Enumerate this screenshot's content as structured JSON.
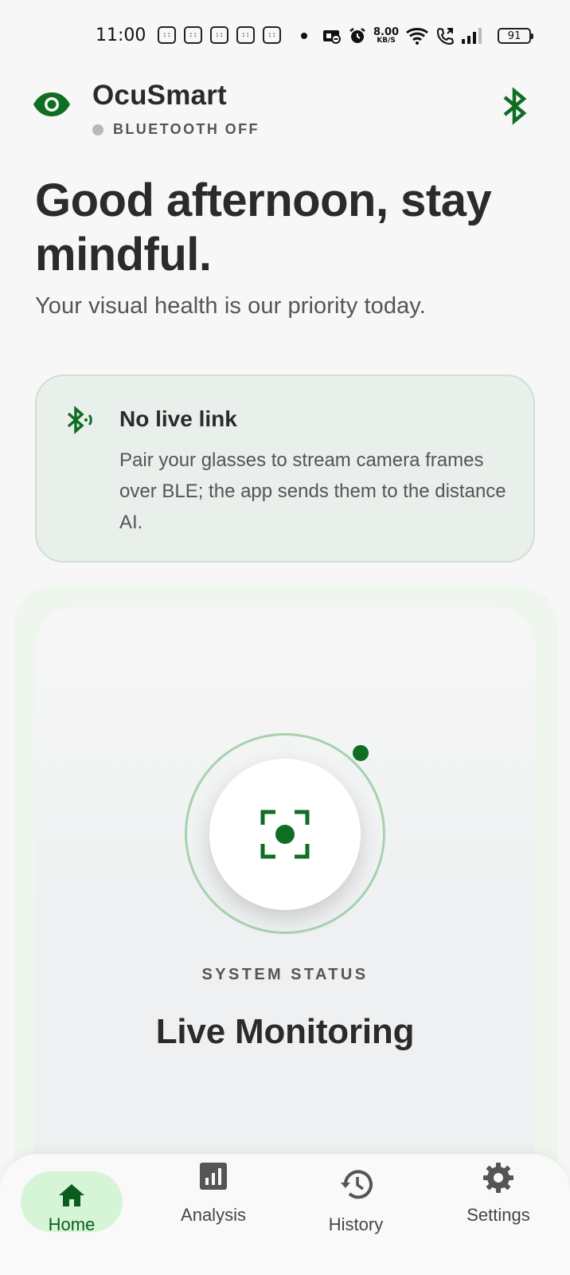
{
  "status_bar": {
    "time": "11:00",
    "notification_glyphs": [
      "::",
      "::",
      "::",
      "::",
      "::"
    ],
    "net_speed_value": "8.00",
    "net_speed_unit": "KB/S",
    "battery": "91"
  },
  "header": {
    "app_name": "OcuSmart",
    "bluetooth_status": "BLUETOOTH OFF",
    "brand_color": "#0f6e23",
    "eye_icon": "eye-icon",
    "bluetooth_icon": "bluetooth-icon"
  },
  "greeting": {
    "title": "Good afternoon, stay mindful.",
    "subtitle": "Your visual health is our priority today."
  },
  "info_card": {
    "icon": "bluetooth-searching-icon",
    "title": "No live link",
    "body": "Pair your glasses to stream camera frames over BLE; the app sends them to the distance AI."
  },
  "status_panel": {
    "label": "SYSTEM STATUS",
    "title": "Live Monitoring",
    "center_icon": "center-focus-icon",
    "indicator_color": "#0f6e23"
  },
  "bottom_nav": {
    "items": [
      {
        "label": "Home",
        "icon": "home-icon",
        "active": true
      },
      {
        "label": "Analysis",
        "icon": "analytics-icon",
        "active": false
      },
      {
        "label": "History",
        "icon": "history-icon",
        "active": false
      },
      {
        "label": "Settings",
        "icon": "settings-icon",
        "active": false
      }
    ]
  }
}
